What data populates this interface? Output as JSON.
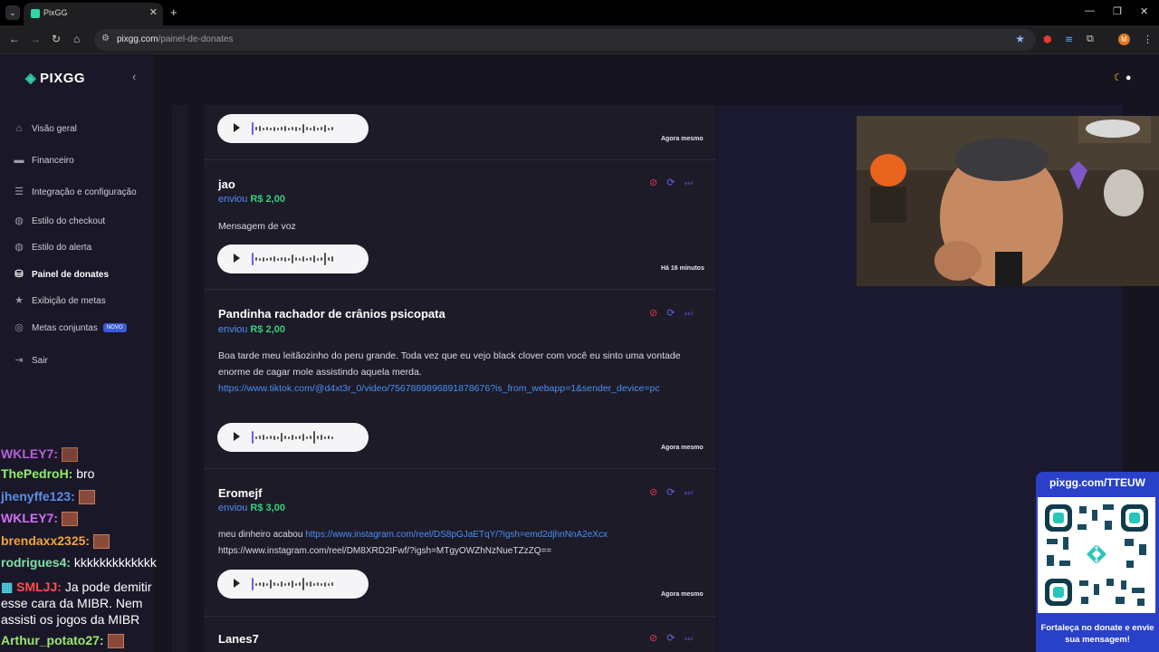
{
  "browser": {
    "tab_title": "PixGG",
    "tab_close": "✕",
    "new_tab": "+",
    "url_host": "pixgg.com",
    "url_path": "/painel-de-donates",
    "profile_initial": "M"
  },
  "app": {
    "logo_text": "PIXGG",
    "collapse_glyph": "‹"
  },
  "sidebar": {
    "items": [
      {
        "label": "Visão geral",
        "icon": "home-icon"
      },
      {
        "label": "Financeiro",
        "icon": "wallet-icon"
      },
      {
        "label": "Integração e configuração",
        "icon": "settings-doc-icon"
      },
      {
        "label": "Estilo do checkout",
        "icon": "palette-icon"
      },
      {
        "label": "Estilo do alerta",
        "icon": "palette-icon"
      },
      {
        "label": "Painel de donates",
        "icon": "coins-icon"
      },
      {
        "label": "Exibição de metas",
        "icon": "star-icon"
      },
      {
        "label": "Metas conjuntas",
        "icon": "target-icon",
        "badge": "NOVO"
      },
      {
        "label": "Sair",
        "icon": "logout-icon"
      }
    ]
  },
  "donations": [
    {
      "name": "",
      "sent": "",
      "amount": "",
      "message": "",
      "time": "Agora mesmo"
    },
    {
      "name": "jao",
      "sent": "enviou",
      "amount": "R$ 2,00",
      "message": "Mensagem de voz",
      "time": "Há 16 minutos"
    },
    {
      "name": "Pandinha rachador de crânios psicopata",
      "sent": "enviou",
      "amount": "R$ 2,00",
      "message": "Boa tarde meu leitãozinho do peru grande. Toda vez que eu vejo black clover com você eu sinto uma vontade enorme de cagar mole assistindo aquela merda.",
      "link": "https://www.tiktok.com/@d4xt3r_0/video/7567889896891878676?is_from_webapp=1&sender_device=pc",
      "time": "Agora mesmo"
    },
    {
      "name": "Eromejf",
      "sent": "enviou",
      "amount": "R$ 3,00",
      "message_prefix": "meu dinheiro acabou",
      "link": "https://www.instagram.com/reel/DS8pGJaETqY/?igsh=emd2djhnNnA2eXcx",
      "message_suffix": "https://www.instagram.com/reel/DM8XRD2tFwf/?igsh=MTgyOWZhNzNueTZzZQ==",
      "time": "Agora mesmo"
    },
    {
      "name": "Lanes7"
    }
  ],
  "overlay": {
    "chat": [
      {
        "user": "WKLEY7:",
        "color": "#d36ef7",
        "text": ""
      },
      {
        "user": "ThePedroH:",
        "color": "#8ff06a",
        "text": "bro"
      },
      {
        "user": "jhenyffe123:",
        "color": "#5b8fe8",
        "text": ""
      },
      {
        "user": "WKLEY7:",
        "color": "#d36ef7",
        "text": ""
      },
      {
        "user": "brendaxx2325:",
        "color": "#f0a43a",
        "text": ""
      },
      {
        "user": "rodrigues4:",
        "color": "#7ee0a6",
        "text": "kkkkkkkkkkkkk"
      },
      {
        "user": "SMLJJ:",
        "color": "#ff4d4d",
        "text": "Ja pode demitir"
      },
      {
        "user": "",
        "color": "#ffffff",
        "text": "esse cara da MIBR. Nem"
      },
      {
        "user": "",
        "color": "#ffffff",
        "text": "assisti os jogos da MIBR"
      },
      {
        "user": "Arthur_potato27:",
        "color": "#9be86b",
        "text": ""
      }
    ],
    "qr_title": "pixgg.com/TTEUW",
    "qr_caption": "Fortaleça no donate e envie sua mensagem!"
  }
}
